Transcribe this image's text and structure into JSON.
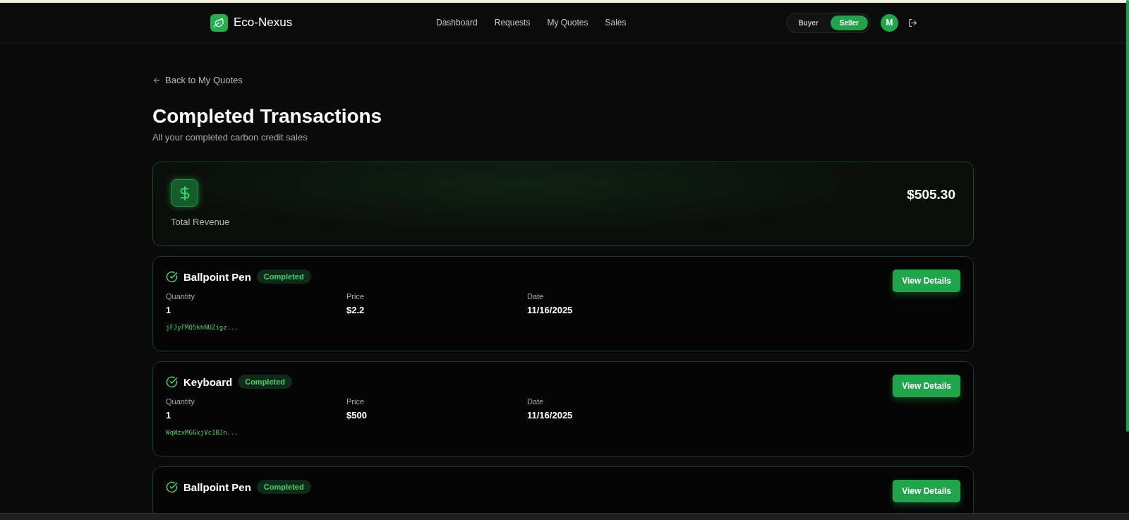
{
  "brand": {
    "name": "Eco-Nexus"
  },
  "nav": [
    {
      "label": "Dashboard"
    },
    {
      "label": "Requests"
    },
    {
      "label": "My Quotes"
    },
    {
      "label": "Sales"
    }
  ],
  "role_toggle": [
    {
      "label": "Buyer",
      "selected": false
    },
    {
      "label": "Seller",
      "selected": true
    }
  ],
  "avatar": {
    "initial": "M"
  },
  "back_link": "Back to My Quotes",
  "title": "Completed Transactions",
  "subtitle": "All your completed carbon credit sales",
  "revenue": {
    "label": "Total Revenue",
    "amount": "$505.30"
  },
  "transactions": [
    {
      "name": "Ballpoint Pen",
      "status": "Completed",
      "fields": [
        {
          "label": "Quantity",
          "value": "1"
        },
        {
          "label": "Price",
          "value": "$2.2"
        },
        {
          "label": "Date",
          "value": "11/16/2025"
        }
      ],
      "hash": "jFJyFMQ5khNUZigz...",
      "action": "View Details"
    },
    {
      "name": "Keyboard",
      "status": "Completed",
      "fields": [
        {
          "label": "Quantity",
          "value": "1"
        },
        {
          "label": "Price",
          "value": "$500"
        },
        {
          "label": "Date",
          "value": "11/16/2025"
        }
      ],
      "hash": "WqWzxMGGxjVc1BJn...",
      "action": "View Details"
    },
    {
      "name": "Ballpoint Pen",
      "status": "Completed",
      "action": "View Details"
    }
  ]
}
